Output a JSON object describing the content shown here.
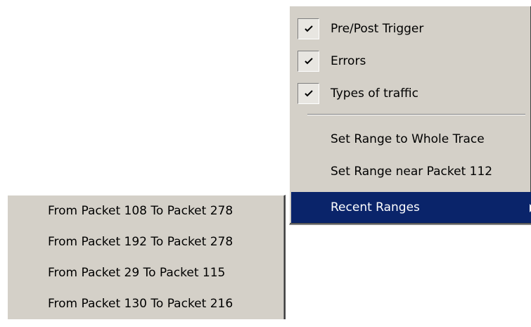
{
  "menu": {
    "items": [
      {
        "label": "Pre/Post Trigger",
        "checked": true,
        "check_icon": "check-icon"
      },
      {
        "label": "Errors",
        "checked": true,
        "check_icon": "check-icon"
      },
      {
        "label": "Types of traffic",
        "checked": true,
        "check_icon": "check-icon"
      },
      {
        "label": "Set Range to Whole Trace",
        "checked": false
      },
      {
        "label": "Set Range near Packet 112",
        "checked": false
      },
      {
        "label": "Recent Ranges",
        "checked": false,
        "highlighted": true,
        "submenu_icon": "submenu-arrow-icon"
      }
    ]
  },
  "submenu": {
    "items": [
      {
        "label": "From Packet 108 To Packet 278"
      },
      {
        "label": "From Packet 192 To Packet 278"
      },
      {
        "label": "From Packet 29 To Packet 115"
      },
      {
        "label": "From Packet 130 To Packet 216"
      }
    ]
  },
  "colors": {
    "menu_background": "#d4d0c8",
    "highlight_background": "#0a246a",
    "highlight_text": "#ffffff",
    "text": "#000000"
  }
}
